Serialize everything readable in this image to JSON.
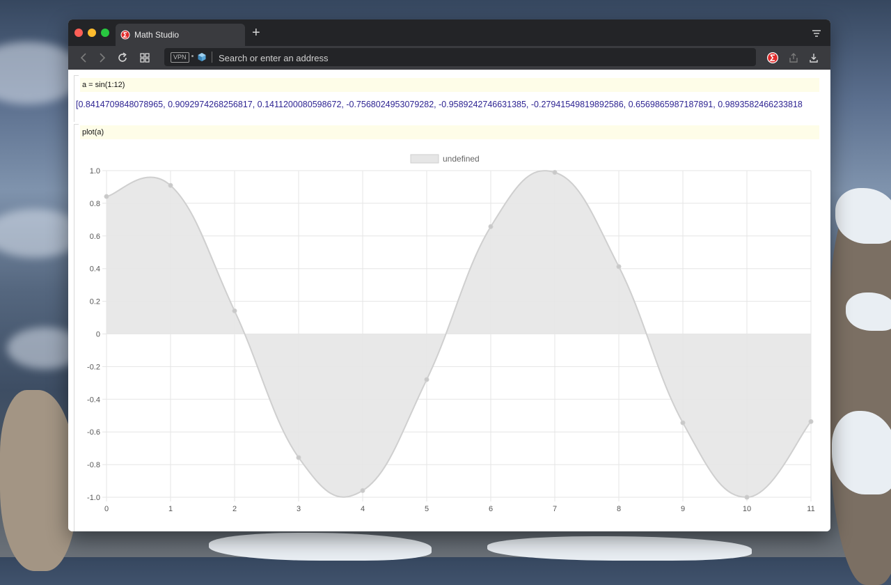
{
  "browser": {
    "tab_title": "Math Studio",
    "new_tab_label": "+",
    "address": {
      "vpn_badge": "VPN",
      "placeholder": "Search or enter an address",
      "value": ""
    }
  },
  "notebook": {
    "cells": [
      {
        "input": "a = sin(1:12)",
        "output": "[0.8414709848078965, 0.9092974268256817, 0.1411200080598672, -0.7568024953079282, -0.9589242746631385, -0.27941549819892586, 0.6569865987187891, 0.9893582466233818"
      },
      {
        "input": "plot(a)"
      }
    ]
  },
  "chart_data": {
    "type": "area",
    "legend": [
      "undefined"
    ],
    "legend_position": "top-center",
    "x": [
      0,
      1,
      2,
      3,
      4,
      5,
      6,
      7,
      8,
      9,
      10,
      11
    ],
    "series": [
      {
        "name": "undefined",
        "values": [
          0.8414709848078965,
          0.9092974268256817,
          0.1411200080598672,
          -0.7568024953079282,
          -0.9589242746631385,
          -0.27941549819892586,
          0.6569865987187891,
          0.9893582466233818,
          0.4121184852417566,
          -0.5440211108893698,
          -0.9999902065507035,
          -0.5365729180004349
        ]
      }
    ],
    "xlim": [
      0,
      11
    ],
    "ylim": [
      -1.0,
      1.0
    ],
    "yticks": [
      "1.0",
      "0.8",
      "0.6",
      "0.4",
      "0.2",
      "0",
      "-0.2",
      "-0.4",
      "-0.6",
      "-0.8",
      "-1.0"
    ],
    "xticks": [
      "0",
      "1",
      "2",
      "3",
      "4",
      "5",
      "6",
      "7",
      "8",
      "9",
      "10",
      "11"
    ],
    "grid": true,
    "colors": {
      "fill": "#e6e6e6",
      "line": "#cfcfcf",
      "point": "#c8c8c8",
      "grid": "#e5e5e5",
      "tick": "#555555"
    }
  }
}
